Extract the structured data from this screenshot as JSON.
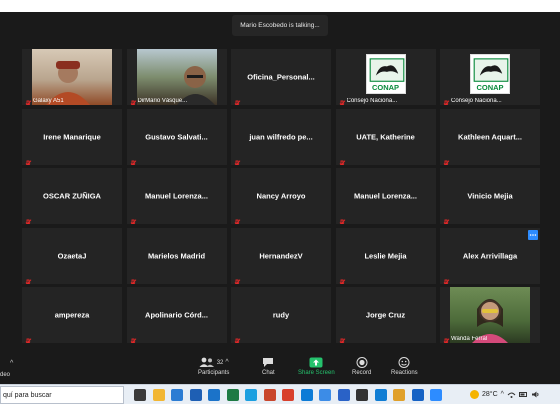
{
  "meeting": {
    "talking_banner": "Mario Escobedo is talking..."
  },
  "tiles": [
    {
      "type": "video",
      "label": "Galaxy A51"
    },
    {
      "type": "video",
      "label": "DirMario Vásque..."
    },
    {
      "type": "name",
      "name": "Oficina_Personal..."
    },
    {
      "type": "logo",
      "logo_text": "CONAP",
      "label": "Consejo Naciona..."
    },
    {
      "type": "logo",
      "logo_text": "CONAP",
      "label": "Consejo Naciona..."
    },
    {
      "type": "name",
      "name": "Irene Manarique"
    },
    {
      "type": "name",
      "name": "Gustavo  Salvati..."
    },
    {
      "type": "name",
      "name": "juan wilfredo pe..."
    },
    {
      "type": "name",
      "name": "UATE, Katherine"
    },
    {
      "type": "name",
      "name": "Kathleen  Aquart..."
    },
    {
      "type": "name",
      "name": "OSCAR ZUÑIGA"
    },
    {
      "type": "name",
      "name": "Manuel  Lorenza..."
    },
    {
      "type": "name",
      "name": "Nancy Arroyo"
    },
    {
      "type": "name",
      "name": "Manuel  Lorenza..."
    },
    {
      "type": "name",
      "name": "Vinicio Mejia"
    },
    {
      "type": "name",
      "name": "OzaetaJ"
    },
    {
      "type": "name",
      "name": "Marielos Madrid"
    },
    {
      "type": "name",
      "name": "HernandezV"
    },
    {
      "type": "name",
      "name": "Leslie Mejia"
    },
    {
      "type": "name",
      "name": "Alex Arrivillaga",
      "badge": true
    },
    {
      "type": "name",
      "name": "ampereza"
    },
    {
      "type": "name",
      "name": "Apolinario  Córd..."
    },
    {
      "type": "name",
      "name": "rudy"
    },
    {
      "type": "name",
      "name": "Jorge Cruz"
    },
    {
      "type": "video",
      "label": "Wanda Ferral"
    }
  ],
  "toolbar": {
    "video_label": "deo",
    "participants_label": "Participants",
    "participants_count": "32",
    "chat_label": "Chat",
    "share_label": "Share Screen",
    "record_label": "Record",
    "reactions_label": "Reactions"
  },
  "taskbar": {
    "search_text": "quí para buscar",
    "temperature": "28°C",
    "icons": [
      "task-view-icon",
      "file-explorer-icon",
      "store-icon",
      "word-icon",
      "mail-icon",
      "excel-icon",
      "skype-icon",
      "powerpoint-icon",
      "chrome-icon",
      "edge-icon",
      "onedrive-icon",
      "calendar-icon",
      "settings-icon",
      "edge-browser-icon",
      "chrome-alt-icon",
      "photos-icon",
      "zoom-icon"
    ]
  },
  "colors": {
    "meeting_bg": "#1a1a1a",
    "tile_bg": "#242424",
    "accent": "#2d8cff",
    "mic_red": "#e02828",
    "share_green": "#25c26d"
  }
}
